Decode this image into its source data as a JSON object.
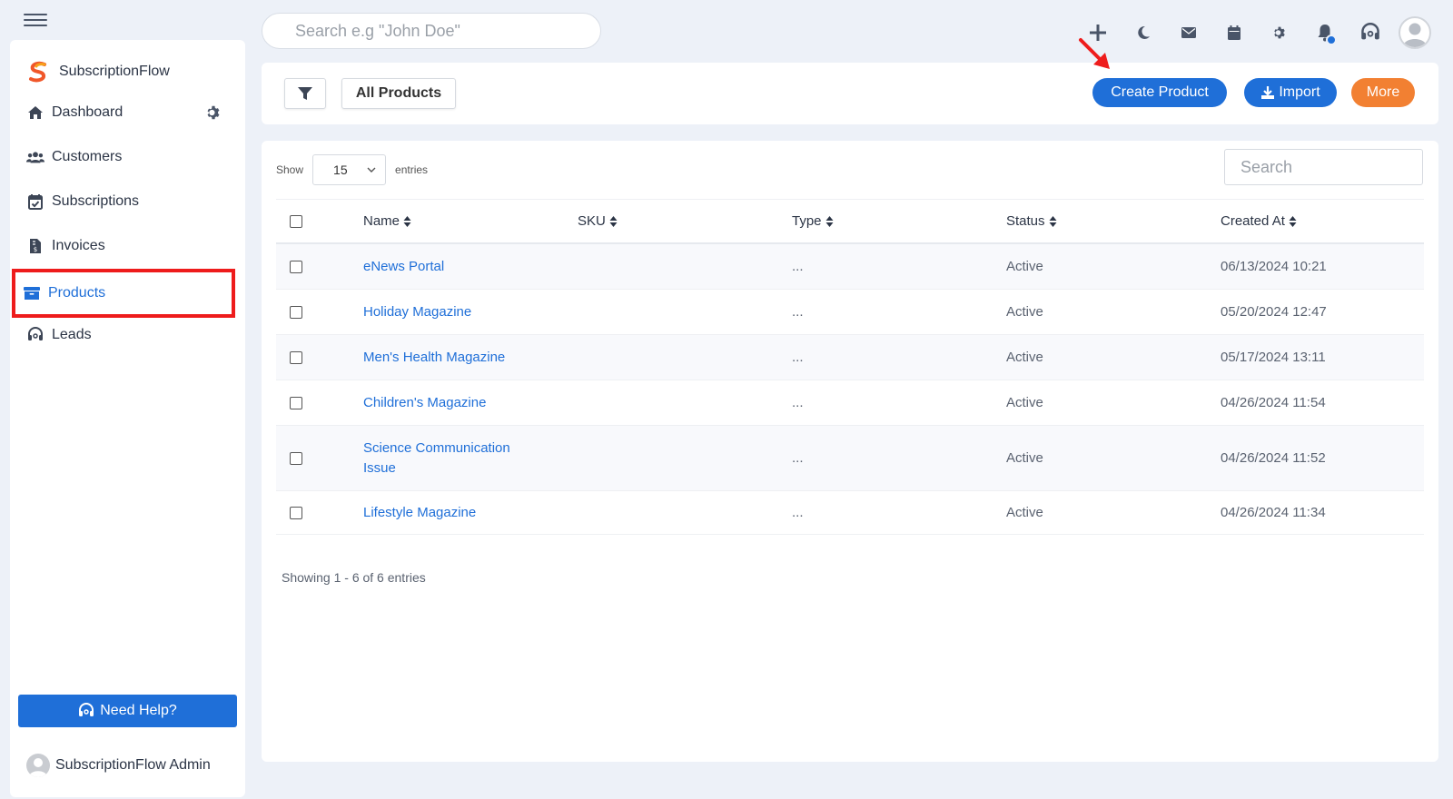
{
  "header": {
    "search_placeholder": "Search e.g \"John Doe\"",
    "icons": [
      "plus-icon",
      "moon-icon",
      "mail-icon",
      "calendar-icon",
      "gear-icon",
      "bell-icon",
      "headset-icon",
      "user-avatar"
    ]
  },
  "sidebar": {
    "brand": "SubscriptionFlow",
    "items": [
      {
        "label": "Dashboard",
        "icon": "home-icon"
      },
      {
        "label": "Customers",
        "icon": "users-icon"
      },
      {
        "label": "Subscriptions",
        "icon": "calendar-check-icon"
      },
      {
        "label": "Invoices",
        "icon": "invoice-icon"
      },
      {
        "label": "Products",
        "icon": "archive-icon",
        "active": true
      },
      {
        "label": "Leads",
        "icon": "headset-icon"
      }
    ],
    "help_label": "Need Help?",
    "admin_name": "SubscriptionFlow Admin"
  },
  "toolbar": {
    "all_products_label": "All Products",
    "create_label": "Create Product",
    "import_label": "Import",
    "more_label": "More"
  },
  "table": {
    "show_label": "Show",
    "entries_value": "15",
    "entries_label": "entries",
    "search_placeholder": "Search",
    "columns": [
      "Name",
      "SKU",
      "Type",
      "Status",
      "Created At"
    ],
    "rows": [
      {
        "name": "eNews Portal",
        "sku": "",
        "type": "...",
        "status": "Active",
        "created": "06/13/2024 10:21"
      },
      {
        "name": "Holiday Magazine",
        "sku": "",
        "type": "...",
        "status": "Active",
        "created": "05/20/2024 12:47"
      },
      {
        "name": "Men's Health Magazine",
        "sku": "",
        "type": "...",
        "status": "Active",
        "created": "05/17/2024 13:11"
      },
      {
        "name": "Children's Magazine",
        "sku": "",
        "type": "...",
        "status": "Active",
        "created": "04/26/2024 11:54"
      },
      {
        "name": "Science Communication Issue",
        "sku": "",
        "type": "...",
        "status": "Active",
        "created": "04/26/2024 11:52"
      },
      {
        "name": "Lifestyle Magazine",
        "sku": "",
        "type": "...",
        "status": "Active",
        "created": "04/26/2024 11:34"
      }
    ],
    "footer_info": "Showing 1 - 6 of 6 entries"
  },
  "colors": {
    "accent": "#1f6fd8",
    "more": "#f28032",
    "highlight": "#ee1c1c"
  }
}
